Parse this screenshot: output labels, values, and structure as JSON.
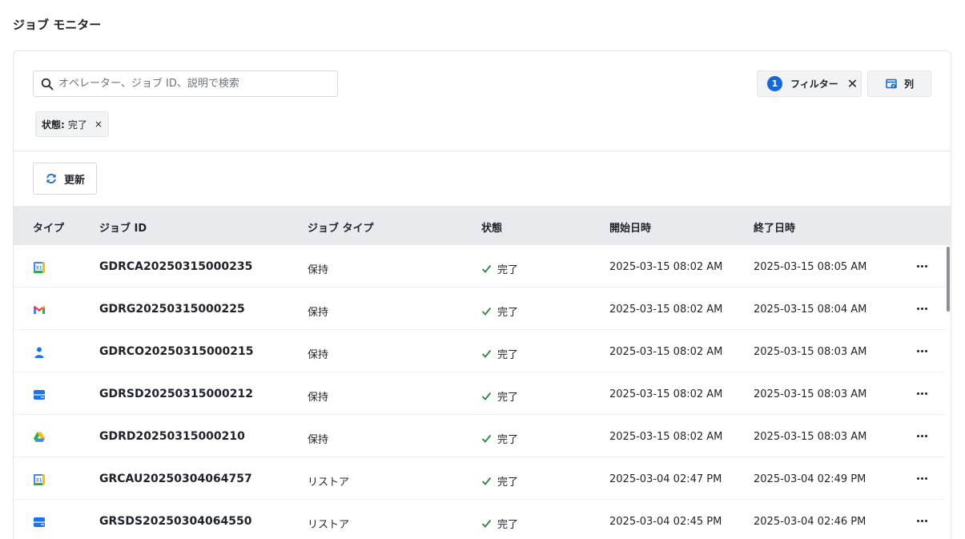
{
  "page_title": "ジョブ モニター",
  "search": {
    "placeholder": "オペレーター、ジョブ ID、説明で検索",
    "value": ""
  },
  "filter_button": {
    "count": "1",
    "label": "フィルター",
    "clear_symbol": "✕"
  },
  "columns_button": {
    "label": "列",
    "icon": "columns-settings-icon"
  },
  "active_filter": {
    "label": "状態:",
    "value": "完了",
    "remove_symbol": "×"
  },
  "refresh_button": {
    "label": "更新",
    "icon": "refresh-icon"
  },
  "table": {
    "headers": [
      "タイプ",
      "ジョブ ID",
      "ジョブ タイプ",
      "状態",
      "開始日時",
      "終了日時"
    ],
    "rows": [
      {
        "icon": "google-calendar-icon",
        "job_id": "GDRCA20250315000235",
        "job_type": "保持",
        "status": "完了",
        "start": "2025-03-15 08:02 AM",
        "end": "2025-03-15 08:05 AM"
      },
      {
        "icon": "gmail-icon",
        "job_id": "GDRG20250315000225",
        "job_type": "保持",
        "status": "完了",
        "start": "2025-03-15 08:02 AM",
        "end": "2025-03-15 08:04 AM"
      },
      {
        "icon": "contacts-icon",
        "job_id": "GDRCO20250315000215",
        "job_type": "保持",
        "status": "完了",
        "start": "2025-03-15 08:02 AM",
        "end": "2025-03-15 08:03 AM"
      },
      {
        "icon": "shared-drive-icon",
        "job_id": "GDRSD20250315000212",
        "job_type": "保持",
        "status": "完了",
        "start": "2025-03-15 08:02 AM",
        "end": "2025-03-15 08:03 AM"
      },
      {
        "icon": "google-drive-icon",
        "job_id": "GDRD20250315000210",
        "job_type": "保持",
        "status": "完了",
        "start": "2025-03-15 08:02 AM",
        "end": "2025-03-15 08:03 AM"
      },
      {
        "icon": "google-calendar-icon",
        "job_id": "GRCAU20250304064757",
        "job_type": "リストア",
        "status": "完了",
        "start": "2025-03-04 02:47 PM",
        "end": "2025-03-04 02:49 PM"
      },
      {
        "icon": "shared-drive-icon",
        "job_id": "GRSDS20250304064550",
        "job_type": "リストア",
        "status": "完了",
        "start": "2025-03-04 02:45 PM",
        "end": "2025-03-04 02:46 PM"
      }
    ]
  },
  "colors": {
    "accent": "#1469d6",
    "success": "#2e8540",
    "header_bg": "#e8eaed"
  }
}
